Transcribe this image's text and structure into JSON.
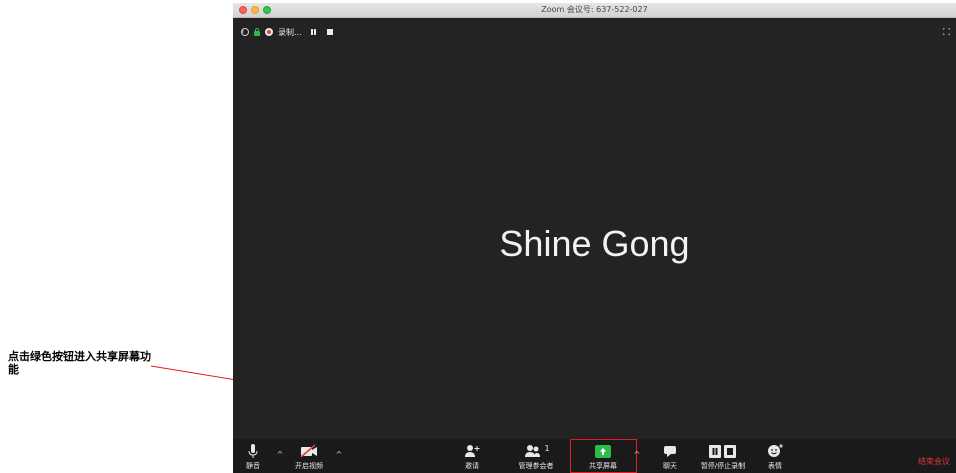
{
  "annotation": {
    "text": "点击绿色按钮进入共享屏幕功能"
  },
  "window": {
    "title": "Zoom 会议号: 637-522-027"
  },
  "status_strip": {
    "recording_label": "录制..."
  },
  "participant": {
    "name": "Shine Gong"
  },
  "toolbar": {
    "mute_label": "静音",
    "video_label": "开启视频",
    "invite_label": "邀请",
    "participants_label": "管理参会者",
    "participants_count": "1",
    "share_label": "共享屏幕",
    "chat_label": "聊天",
    "record_label": "暂停/停止录制",
    "reactions_label": "表情",
    "end_label": "结束会议",
    "caret": "^"
  },
  "colors": {
    "share_green": "#2bbd49",
    "end_red": "#e0383e",
    "annotation_red": "#e02020",
    "background": "#232323"
  },
  "icons": [
    "mic-icon",
    "video-off-icon",
    "invite-icon",
    "participants-icon",
    "share-screen-icon",
    "chat-icon",
    "record-controls-icon",
    "reaction-icon",
    "fullscreen-icon",
    "info-icon",
    "lock-icon",
    "record-icon"
  ]
}
